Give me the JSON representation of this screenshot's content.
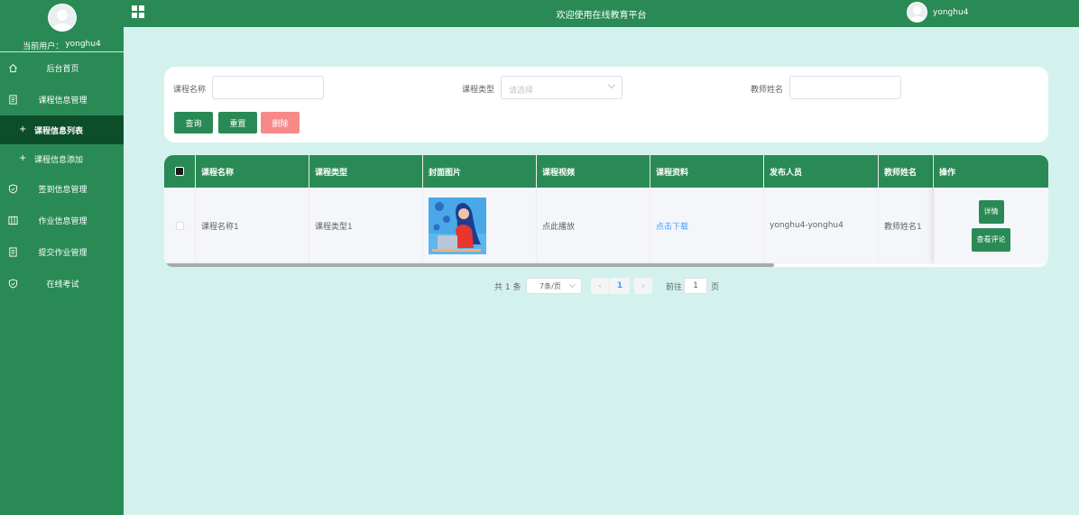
{
  "sidebar": {
    "current_user_label": "当前用户：",
    "current_user_name": "yonghu4",
    "items": [
      {
        "label": "后台首页",
        "icon": "home-icon"
      },
      {
        "label": "课程信息管理",
        "icon": "document-icon"
      },
      {
        "label": "课程信息列表",
        "sub": true,
        "active": true
      },
      {
        "label": "课程信息添加",
        "sub": true
      },
      {
        "label": "签到信息管理",
        "icon": "shield-icon"
      },
      {
        "label": "作业信息管理",
        "icon": "columns-icon"
      },
      {
        "label": "提交作业管理",
        "icon": "document-icon"
      },
      {
        "label": "在线考试",
        "icon": "shield-icon"
      }
    ]
  },
  "header": {
    "title": "欢迎使用在线教育平台",
    "user_name": "yonghu4"
  },
  "search": {
    "course_name_label": "课程名称",
    "course_name_value": "",
    "course_type_label": "课程类型",
    "course_type_placeholder": "请选择",
    "teacher_name_label": "教师姓名",
    "teacher_name_value": "",
    "query_label": "查询",
    "reset_label": "重置",
    "delete_label": "删除"
  },
  "table": {
    "columns": [
      "课程名称",
      "课程类型",
      "封面图片",
      "课程视频",
      "课程资料",
      "发布人员",
      "教师姓名",
      "操作"
    ],
    "rows": [
      {
        "course_name": "课程名称1",
        "course_type": "课程类型1",
        "video": "点此播放",
        "material": "点击下载",
        "publisher": "yonghu4-yonghu4",
        "teacher": "教师姓名1",
        "detail_label": "详情",
        "comment_label": "查看评论"
      }
    ]
  },
  "pagination": {
    "total": "共 1 条",
    "page_size": "7条/页",
    "current_page": "1",
    "goto_label": "前往",
    "goto_value": "1",
    "page_suffix": "页"
  },
  "colors": {
    "primary": "#2a8a55",
    "active_menu": "#0c4e29",
    "background": "#d3f2ee",
    "danger": "#f78989",
    "link": "#409eff"
  }
}
